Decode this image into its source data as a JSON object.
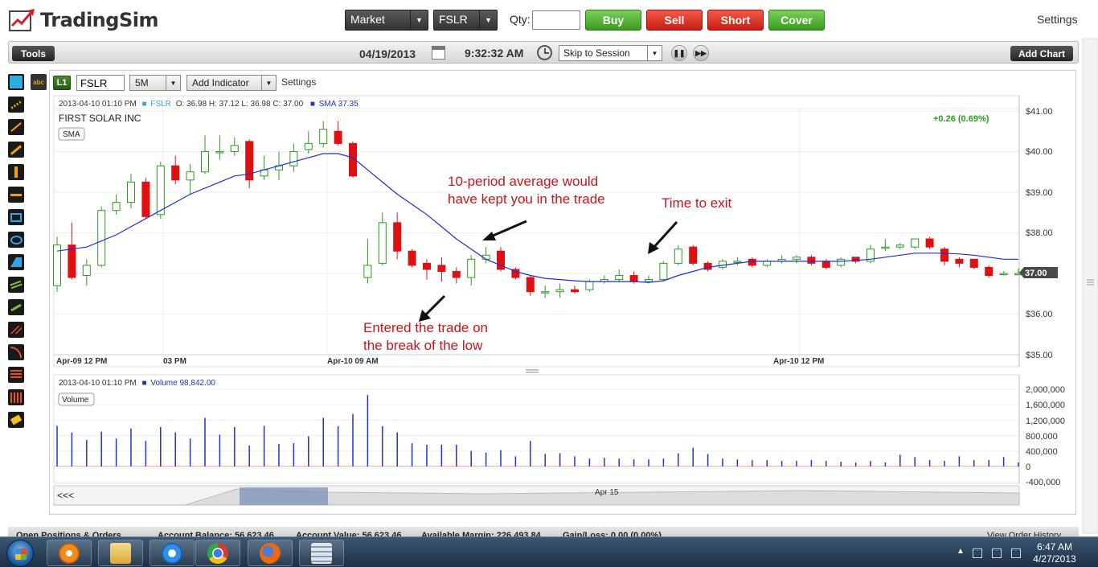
{
  "app": {
    "logo_text": "TradingSim",
    "settings_label": "Settings"
  },
  "order_bar": {
    "order_type": "Market",
    "symbol": "FSLR",
    "qty_label": "Qty:",
    "qty_value": "",
    "buy_label": "Buy",
    "sell_label": "Sell",
    "short_label": "Short",
    "cover_label": "Cover",
    "colors": {
      "buy": "#3a9a1e",
      "sell": "#c81c10",
      "short": "#c81c10",
      "cover": "#3a9a1e"
    }
  },
  "session_bar": {
    "tools_label": "Tools",
    "date": "04/19/2013",
    "time": "9:32:32 AM",
    "skip_select": "Skip to Session",
    "pause_icon": "pause-icon",
    "fast_forward_icon": "fast-forward-icon",
    "add_chart_label": "Add Chart"
  },
  "chart_header": {
    "level_badge": "L1",
    "symbol_input": "FSLR",
    "interval": "5M",
    "add_indicator": "Add Indicator",
    "settings": "Settings"
  },
  "price_panel": {
    "info_date": "2013-04-10 01:10 PM",
    "info_symbol": "FSLR",
    "info_ohlc": "O: 36.98  H: 37.12  L: 36.98  C: 37.00",
    "info_sma": "SMA 37.35",
    "company": "FIRST SOLAR INC",
    "sma_badge": "SMA",
    "change": "+0.26 (0.69%)",
    "last_price_label": "37.00",
    "y_ticks": [
      "$41.00",
      "$40.00",
      "$39.00",
      "$38.00",
      "$37.00",
      "$36.00",
      "$35.00"
    ],
    "x_ticks": [
      "Apr-09 12 PM",
      "03 PM",
      "Apr-10 09 AM",
      "Apr-10 12 PM"
    ]
  },
  "volume_panel": {
    "info_date": "2013-04-10 01:10 PM",
    "info_volume": "Volume 98,842.00",
    "badge": "Volume",
    "y_ticks": [
      "2,000,000",
      "1,600,000",
      "1,200,000",
      "800,000",
      "400,000",
      "0",
      "-400,000"
    ]
  },
  "navigator": {
    "back_label": "<<<",
    "date_label": "Apr 15"
  },
  "annotations": [
    {
      "id": "entered",
      "lines": [
        "Entered the trade on",
        "the break of the low"
      ]
    },
    {
      "id": "average",
      "lines": [
        "10-period average would",
        "have kept you in the trade"
      ]
    },
    {
      "id": "exit",
      "lines": [
        "Time to exit"
      ]
    }
  ],
  "bottom_bar": {
    "open_positions": "Open Positions & Orders",
    "account_balance": "Account Balance: 56,623.46",
    "account_value": "Account Value: 56,623.46",
    "available_margin": "Available Margin: 226,493.84",
    "gain_loss": "Gain/Loss: 0.00 (0.00%)",
    "view_order_history": "View Order History"
  },
  "taskbar": {
    "time": "6:47 AM",
    "date": "4/27/2013",
    "apps": [
      "media-player-icon",
      "file-explorer-icon",
      "internet-explorer-icon",
      "chrome-icon",
      "firefox-icon",
      "calculator-icon"
    ]
  },
  "chart_data": {
    "type": "candlestick",
    "symbol": "FSLR",
    "ylim": [
      35.0,
      41.2
    ],
    "y_ticks": [
      41,
      40,
      39,
      38,
      37,
      36,
      35
    ],
    "up_color": "#2a9d1f",
    "down_color": "#e01010",
    "sma_color": "#1f2fd6",
    "candles": [
      {
        "o": 36.7,
        "h": 37.9,
        "l": 36.55,
        "c": 37.7
      },
      {
        "o": 37.7,
        "h": 38.25,
        "l": 36.85,
        "c": 36.9
      },
      {
        "o": 36.95,
        "h": 37.35,
        "l": 36.7,
        "c": 37.2
      },
      {
        "o": 37.2,
        "h": 38.65,
        "l": 37.15,
        "c": 38.55
      },
      {
        "o": 38.55,
        "h": 38.95,
        "l": 38.45,
        "c": 38.75
      },
      {
        "o": 38.75,
        "h": 39.45,
        "l": 38.6,
        "c": 39.25
      },
      {
        "o": 39.25,
        "h": 39.35,
        "l": 38.35,
        "c": 38.4
      },
      {
        "o": 38.45,
        "h": 39.75,
        "l": 38.35,
        "c": 39.65
      },
      {
        "o": 39.65,
        "h": 39.9,
        "l": 39.2,
        "c": 39.3
      },
      {
        "o": 39.3,
        "h": 39.7,
        "l": 38.95,
        "c": 39.5
      },
      {
        "o": 39.5,
        "h": 40.4,
        "l": 39.45,
        "c": 40.0
      },
      {
        "o": 40.0,
        "h": 40.4,
        "l": 39.8,
        "c": 40.0
      },
      {
        "o": 40.0,
        "h": 40.35,
        "l": 39.9,
        "c": 40.15
      },
      {
        "o": 40.25,
        "h": 40.3,
        "l": 39.1,
        "c": 39.3
      },
      {
        "o": 39.4,
        "h": 39.9,
        "l": 39.3,
        "c": 39.55
      },
      {
        "o": 39.55,
        "h": 40.0,
        "l": 39.3,
        "c": 39.65
      },
      {
        "o": 39.65,
        "h": 40.2,
        "l": 39.5,
        "c": 40.0
      },
      {
        "o": 40.05,
        "h": 40.5,
        "l": 39.95,
        "c": 40.2
      },
      {
        "o": 40.2,
        "h": 40.75,
        "l": 40.1,
        "c": 40.55
      },
      {
        "o": 40.5,
        "h": 40.75,
        "l": 40.15,
        "c": 40.2
      },
      {
        "o": 40.2,
        "h": 40.25,
        "l": 39.35,
        "c": 39.4
      },
      {
        "o": 36.9,
        "h": 37.85,
        "l": 36.75,
        "c": 37.2
      },
      {
        "o": 37.25,
        "h": 38.5,
        "l": 37.2,
        "c": 38.25
      },
      {
        "o": 38.25,
        "h": 38.5,
        "l": 37.35,
        "c": 37.55
      },
      {
        "o": 37.55,
        "h": 37.6,
        "l": 37.15,
        "c": 37.2
      },
      {
        "o": 37.25,
        "h": 37.35,
        "l": 36.85,
        "c": 37.1
      },
      {
        "o": 37.2,
        "h": 37.4,
        "l": 36.8,
        "c": 37.05
      },
      {
        "o": 37.05,
        "h": 37.15,
        "l": 36.75,
        "c": 36.9
      },
      {
        "o": 36.9,
        "h": 37.45,
        "l": 36.7,
        "c": 37.35
      },
      {
        "o": 37.35,
        "h": 37.65,
        "l": 37.25,
        "c": 37.45
      },
      {
        "o": 37.55,
        "h": 37.65,
        "l": 37.05,
        "c": 37.1
      },
      {
        "o": 37.1,
        "h": 37.15,
        "l": 36.85,
        "c": 36.9
      },
      {
        "o": 36.9,
        "h": 36.95,
        "l": 36.45,
        "c": 36.55
      },
      {
        "o": 36.55,
        "h": 36.7,
        "l": 36.4,
        "c": 36.55
      },
      {
        "o": 36.55,
        "h": 36.75,
        "l": 36.4,
        "c": 36.6
      },
      {
        "o": 36.6,
        "h": 36.7,
        "l": 36.5,
        "c": 36.55
      },
      {
        "o": 36.6,
        "h": 36.85,
        "l": 36.55,
        "c": 36.8
      },
      {
        "o": 36.8,
        "h": 36.95,
        "l": 36.75,
        "c": 36.85
      },
      {
        "o": 36.85,
        "h": 37.1,
        "l": 36.8,
        "c": 36.95
      },
      {
        "o": 36.95,
        "h": 37.05,
        "l": 36.75,
        "c": 36.8
      },
      {
        "o": 36.8,
        "h": 36.95,
        "l": 36.75,
        "c": 36.85
      },
      {
        "o": 36.85,
        "h": 37.3,
        "l": 36.8,
        "c": 37.25
      },
      {
        "o": 37.25,
        "h": 37.7,
        "l": 37.2,
        "c": 37.6
      },
      {
        "o": 37.65,
        "h": 37.7,
        "l": 37.2,
        "c": 37.25
      },
      {
        "o": 37.25,
        "h": 37.3,
        "l": 37.05,
        "c": 37.1
      },
      {
        "o": 37.15,
        "h": 37.35,
        "l": 37.1,
        "c": 37.3
      },
      {
        "o": 37.3,
        "h": 37.4,
        "l": 37.2,
        "c": 37.3
      },
      {
        "o": 37.35,
        "h": 37.4,
        "l": 37.15,
        "c": 37.2
      },
      {
        "o": 37.2,
        "h": 37.35,
        "l": 37.15,
        "c": 37.3
      },
      {
        "o": 37.3,
        "h": 37.45,
        "l": 37.25,
        "c": 37.35
      },
      {
        "o": 37.35,
        "h": 37.45,
        "l": 37.25,
        "c": 37.4
      },
      {
        "o": 37.4,
        "h": 37.45,
        "l": 37.2,
        "c": 37.25
      },
      {
        "o": 37.3,
        "h": 37.35,
        "l": 37.1,
        "c": 37.15
      },
      {
        "o": 37.2,
        "h": 37.4,
        "l": 37.15,
        "c": 37.35
      },
      {
        "o": 37.4,
        "h": 37.4,
        "l": 37.25,
        "c": 37.3
      },
      {
        "o": 37.3,
        "h": 37.7,
        "l": 37.25,
        "c": 37.6
      },
      {
        "o": 37.65,
        "h": 37.85,
        "l": 37.55,
        "c": 37.65
      },
      {
        "o": 37.65,
        "h": 37.75,
        "l": 37.6,
        "c": 37.7
      },
      {
        "o": 37.65,
        "h": 37.85,
        "l": 37.6,
        "c": 37.85
      },
      {
        "o": 37.85,
        "h": 37.9,
        "l": 37.6,
        "c": 37.65
      },
      {
        "o": 37.6,
        "h": 37.65,
        "l": 37.2,
        "c": 37.3
      },
      {
        "o": 37.35,
        "h": 37.4,
        "l": 37.15,
        "c": 37.25
      },
      {
        "o": 37.35,
        "h": 37.35,
        "l": 37.1,
        "c": 37.15
      },
      {
        "o": 37.15,
        "h": 37.2,
        "l": 36.9,
        "c": 36.95
      },
      {
        "o": 37.0,
        "h": 37.05,
        "l": 36.95,
        "c": 37.0
      },
      {
        "o": 36.98,
        "h": 37.12,
        "l": 36.98,
        "c": 37.0
      }
    ],
    "sma": [
      37.55,
      37.6,
      37.65,
      37.8,
      37.95,
      38.15,
      38.35,
      38.55,
      38.75,
      38.95,
      39.1,
      39.25,
      39.4,
      39.45,
      39.55,
      39.65,
      39.75,
      39.85,
      39.95,
      39.95,
      39.85,
      39.55,
      39.25,
      38.95,
      38.7,
      38.45,
      38.15,
      37.85,
      37.6,
      37.35,
      37.2,
      37.05,
      36.95,
      36.88,
      36.85,
      36.82,
      36.8,
      36.8,
      36.8,
      36.8,
      36.78,
      36.82,
      36.95,
      37.05,
      37.15,
      37.2,
      37.25,
      37.3,
      37.3,
      37.3,
      37.3,
      37.3,
      37.3,
      37.3,
      37.32,
      37.35,
      37.4,
      37.45,
      37.5,
      37.5,
      37.5,
      37.48,
      37.45,
      37.4,
      37.35,
      37.35
    ],
    "volume": {
      "ylim": [
        -400000,
        2000000
      ],
      "values": [
        1050000,
        880000,
        680000,
        900000,
        720000,
        980000,
        660000,
        1020000,
        880000,
        720000,
        1260000,
        820000,
        1020000,
        540000,
        1050000,
        580000,
        600000,
        780000,
        1260000,
        1040000,
        1360000,
        1850000,
        1040000,
        880000,
        600000,
        560000,
        560000,
        560000,
        400000,
        360000,
        420000,
        260000,
        660000,
        320000,
        340000,
        260000,
        200000,
        220000,
        200000,
        180000,
        180000,
        200000,
        340000,
        480000,
        320000,
        200000,
        180000,
        160000,
        160000,
        140000,
        140000,
        160000,
        140000,
        120000,
        100000,
        140000,
        100000,
        300000,
        240000,
        160000,
        140000,
        260000,
        160000,
        160000,
        240000,
        98842
      ]
    }
  }
}
